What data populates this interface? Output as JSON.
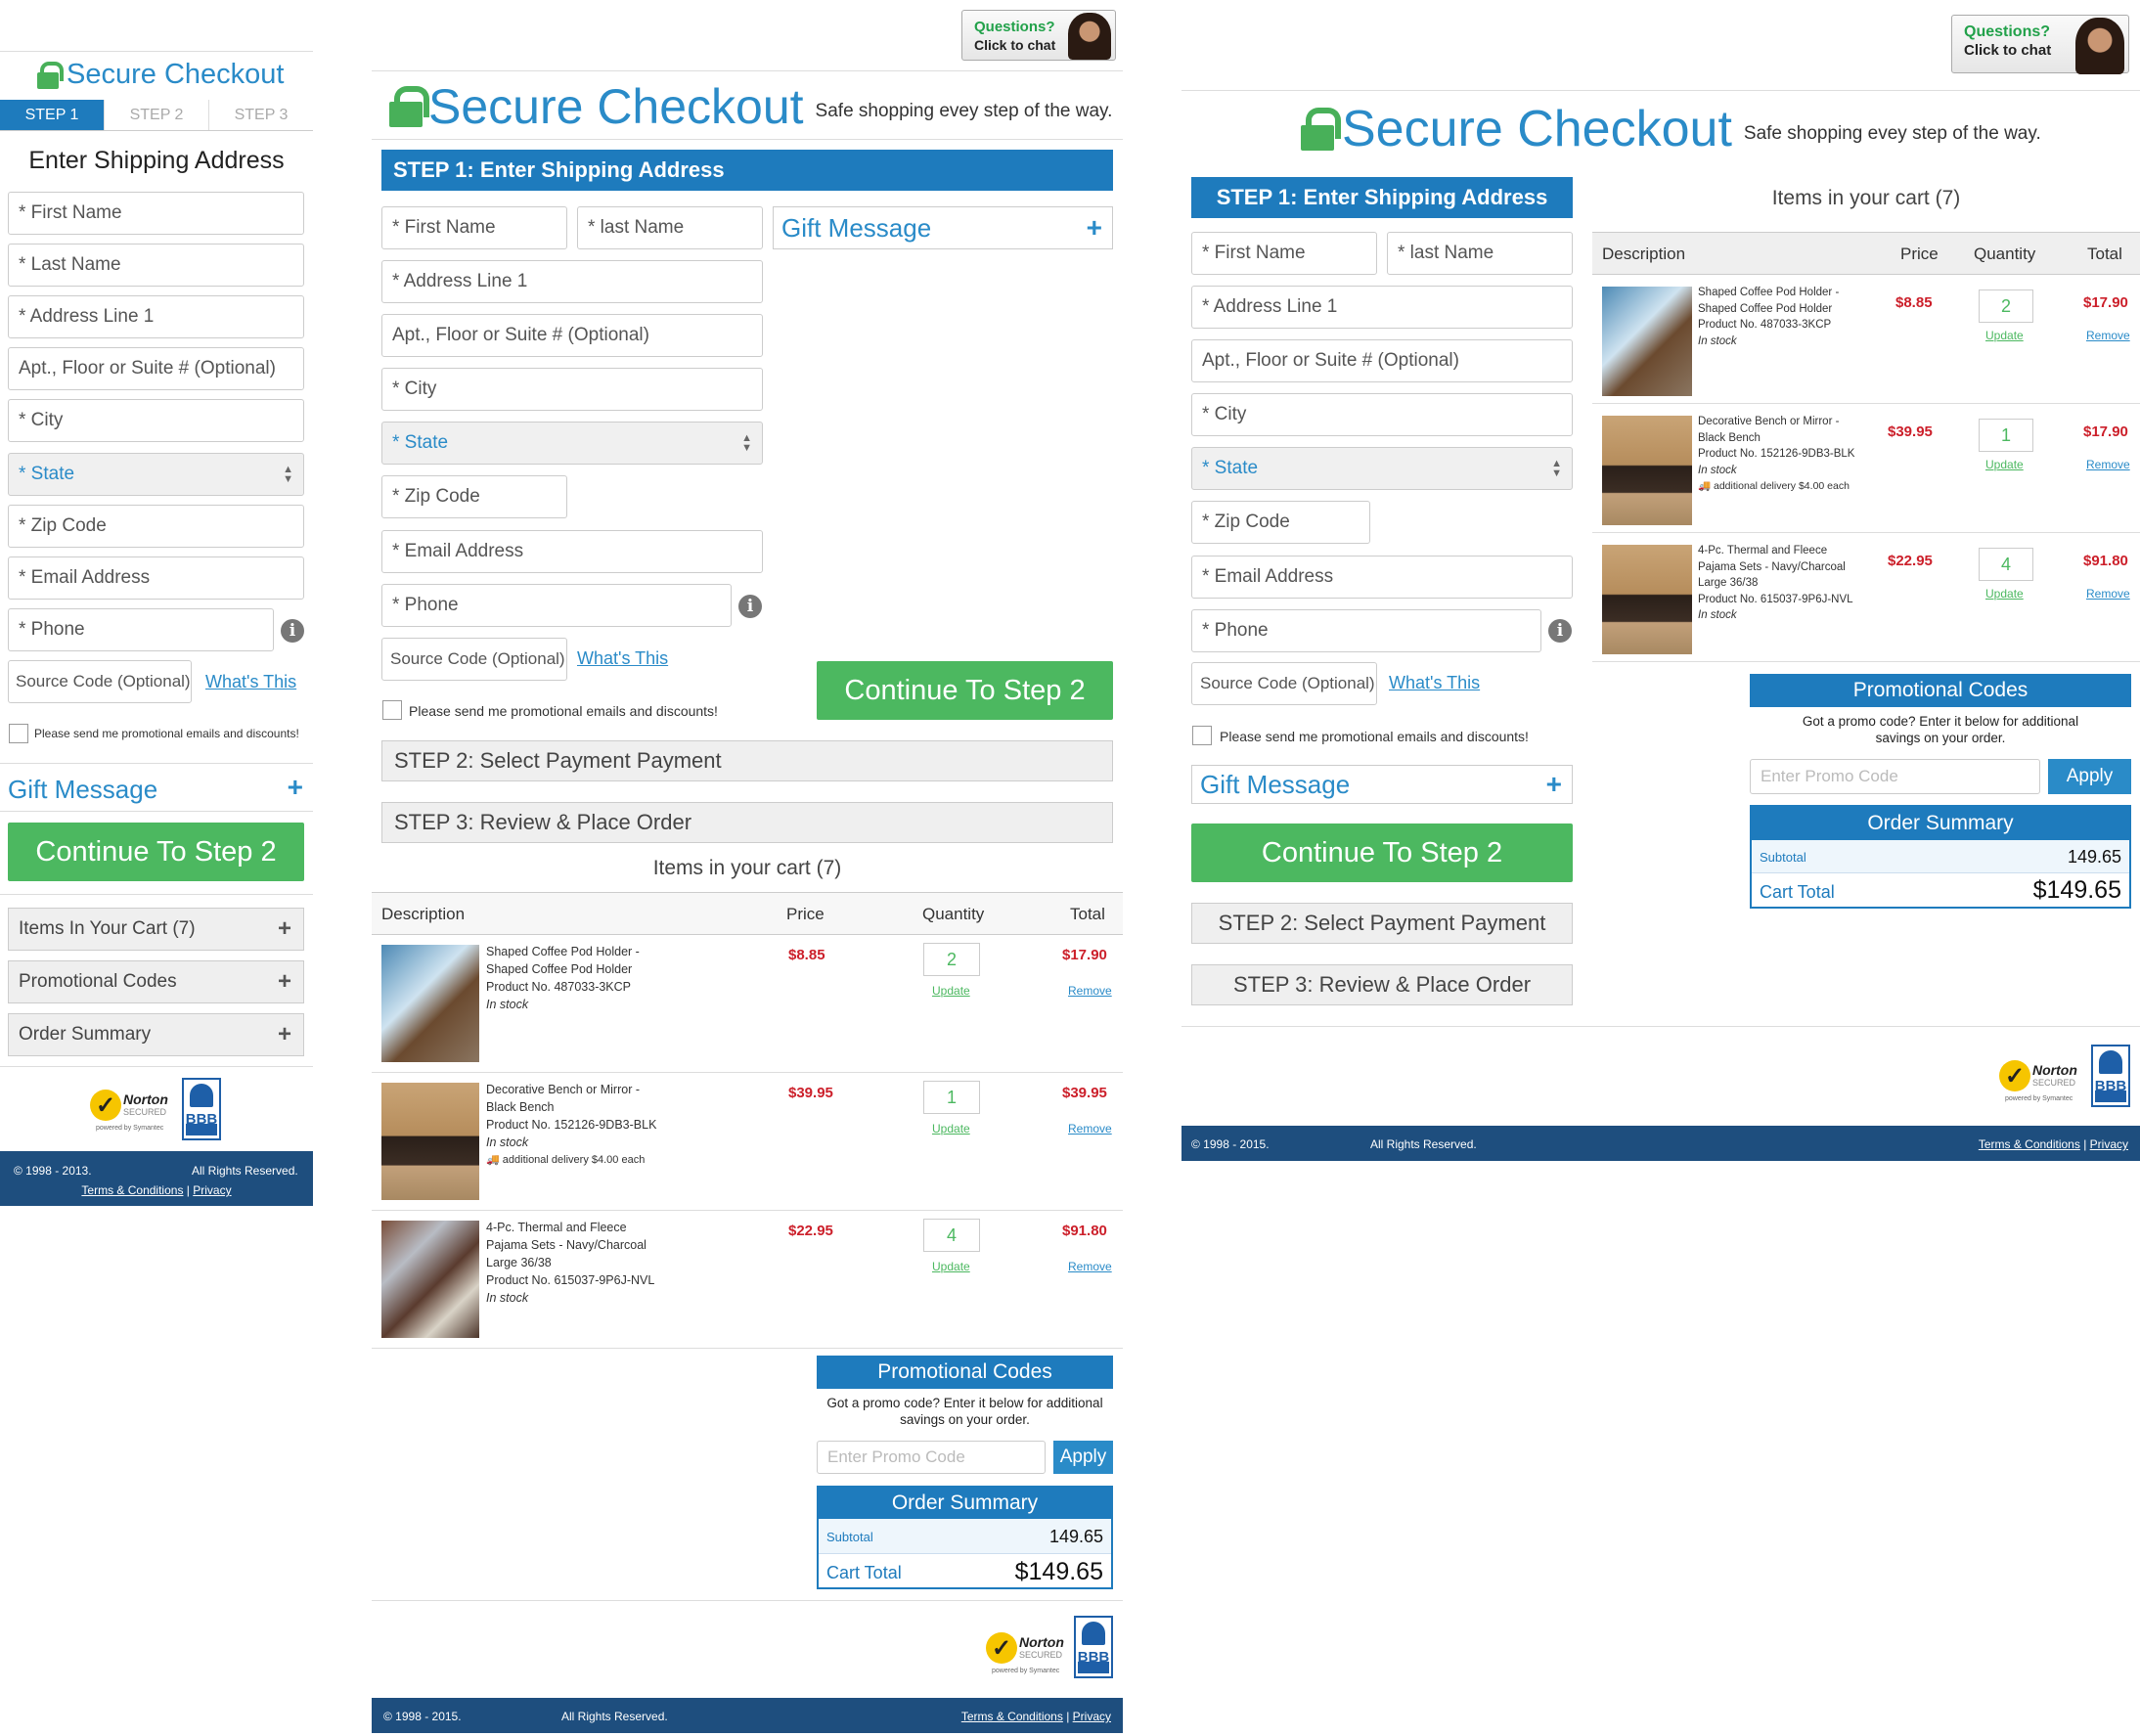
{
  "common": {
    "secure_checkout": "Secure Checkout",
    "tagline": "Safe shopping evey step of the way.",
    "chat_questions": "Questions?",
    "chat_click": "Click to chat",
    "step1_title": "STEP 1: Enter Shipping Address",
    "step2_title": "STEP 2: Select Payment Payment",
    "step3_title": "STEP 3: Review & Place Order",
    "first_name": "* First Name",
    "last_name_cap": "* Last Name",
    "last_name_lower": "* last Name",
    "address1": "* Address Line 1",
    "apt": "Apt., Floor or Suite # (Optional)",
    "city": "* City",
    "state": "* State",
    "zip": "* Zip Code",
    "email": "* Email Address",
    "phone": "* Phone",
    "source_code": "Source Code (Optional)",
    "whats_this": "What's This",
    "promo_emails": "Please send me promotional emails and discounts!",
    "gift_message": "Gift Message",
    "continue_step2": "Continue To Step 2",
    "items_in_cart": "Items in your cart (7)",
    "items_in_cart_mobile": "Items In Your Cart (7)",
    "promotional_codes": "Promotional Codes",
    "order_summary": "Order Summary",
    "promo_help": "Got a promo code? Enter it below for additional savings on your order.",
    "promo_placeholder": "Enter Promo Code",
    "apply": "Apply",
    "subtotal_label": "Subtotal",
    "subtotal_value": "149.65",
    "cart_total_label": "Cart Total",
    "cart_total_value": "$149.65",
    "col_description": "Description",
    "col_price": "Price",
    "col_quantity": "Quantity",
    "col_total": "Total",
    "update": "Update",
    "remove": "Remove",
    "norton_name": "Norton",
    "norton_secured": "SECURED",
    "norton_powered": "powered by Symantec",
    "bbb": "BBB",
    "copyright_2015": "© 1998 - 2015.",
    "copyright_2013": "© 1998 - 2013.",
    "rights": "All Rights Reserved.",
    "terms": "Terms & Conditions",
    "privacy": "Privacy"
  },
  "mobile": {
    "tabs": [
      "STEP 1",
      "STEP 2",
      "STEP 3"
    ],
    "heading": "Enter Shipping Address"
  },
  "cart": [
    {
      "name1": "Shaped Coffee Pod Holder -",
      "name2": "Shaped Coffee Pod Holder",
      "name3": "",
      "product_no": "Product No. 487033-3KCP",
      "stock": "In stock",
      "extra": "",
      "price": "$8.85",
      "qty": "2",
      "total": "$17.90",
      "thumb": "mug"
    },
    {
      "name1": "Decorative Bench or Mirror -",
      "name2": "Black Bench",
      "name3": "",
      "product_no": "Product No. 152126-9DB3-BLK",
      "stock": "In stock",
      "extra": "additional delivery $4.00 each",
      "price": "$39.95",
      "qty": "1",
      "total_tablet": "$39.95",
      "total_desktop": "$17.90",
      "thumb": "bench"
    },
    {
      "name1": "4-Pc. Thermal and Fleece",
      "name2": "Pajama Sets - Navy/Charcoal",
      "name3": "Large 36/38",
      "product_no": "Product No. 615037-9P6J-NVL",
      "stock": "In stock",
      "extra": "",
      "price": "$22.95",
      "qty": "4",
      "total": "$91.80",
      "thumb": "pajama"
    }
  ],
  "colors": {
    "brand_blue": "#1e7bbd",
    "green": "#4cb860",
    "price_red": "#cc1f2a",
    "footer": "#1e4e7e"
  }
}
